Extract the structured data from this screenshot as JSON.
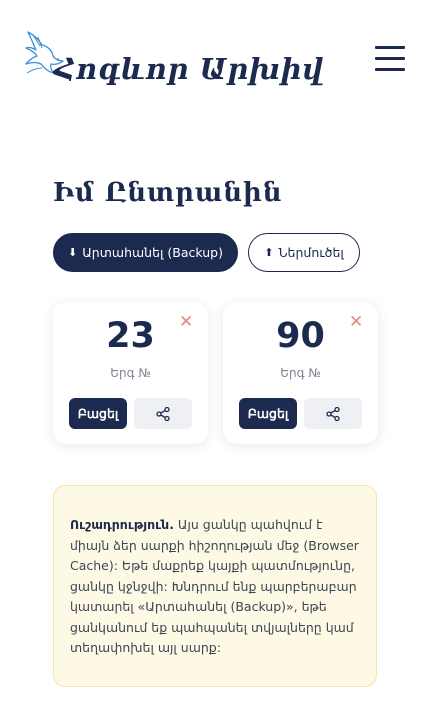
{
  "header": {
    "logo_text": "Հոգևոր Արխիվ",
    "logo_icon": "dove-icon",
    "menu_icon": "hamburger-menu-icon"
  },
  "page": {
    "title": "Իմ Ընտրանին"
  },
  "actions": {
    "export_label": "Արտահանել (Backup)",
    "export_icon": "⬇",
    "import_label": "Ներմուծել",
    "import_icon": "⬆"
  },
  "favorites": [
    {
      "number": "23",
      "label": "Երգ №",
      "open_label": "Բացել"
    },
    {
      "number": "90",
      "label": "Երգ №",
      "open_label": "Բացել"
    }
  ],
  "notice": {
    "title": "Ուշադրություն.",
    "text": "Այս ցանկը պահվում է միայն ձեր սարքի հիշողության մեջ (Browser Cache): Եթե մաքրեք կայքի պատմությունը, ցանկը կջնջվի: Խնդրում ենք պարբերաբար կատարել «Արտահանել (Backup)», եթե ցանկանում եք պահպանել տվյալները կամ տեղափոխել այլ սարք:"
  },
  "colors": {
    "primary": "#1b2a4e",
    "close": "#e08a84",
    "notice_bg": "#fdf9e4"
  }
}
